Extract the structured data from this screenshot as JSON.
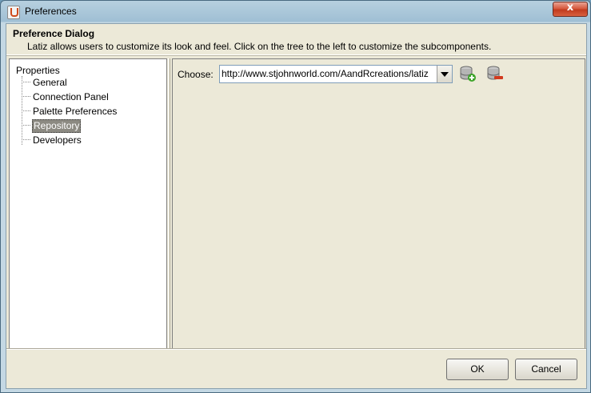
{
  "window": {
    "title": "Preferences",
    "close_glyph": "x"
  },
  "header": {
    "title": "Preference Dialog",
    "description": "Latiz allows users to customize its look and feel. Click on the tree to the left to customize the subcomponents."
  },
  "tree": {
    "root": "Properties",
    "items": [
      {
        "label": "General"
      },
      {
        "label": "Connection Panel"
      },
      {
        "label": "Palette Preferences"
      },
      {
        "label": "Repository",
        "selected": true
      },
      {
        "label": "Developers"
      }
    ]
  },
  "repository": {
    "choose_label": "Choose:",
    "selected_url": "http://www.stjohnworld.com/AandRcreations/latiz",
    "icons": [
      "database-add-icon",
      "database-remove-icon"
    ]
  },
  "buttons": {
    "ok": "OK",
    "cancel": "Cancel"
  },
  "colors": {
    "dialog_bg": "#ece9d8",
    "selection": "#8c8a82",
    "close_red": "#c03b1e"
  }
}
